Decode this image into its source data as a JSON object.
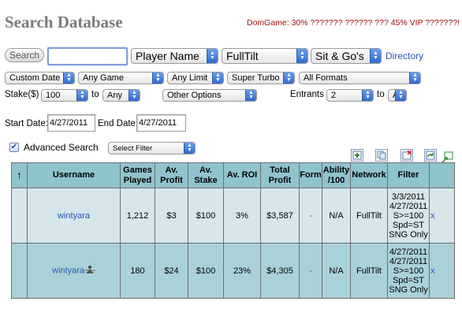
{
  "header": {
    "title": "Search Database",
    "promo": "DomGame: 30% ??????? ?????? ??? 45% VIP ???????!"
  },
  "search": {
    "button_label": "Search",
    "input_value": "",
    "type_select": "Player Name",
    "site_select": "FullTilt",
    "format_select": "Sit & Go's",
    "directory_link": "Directory"
  },
  "filters": {
    "date_select": "Custom Date",
    "game_select": "Any Game",
    "limit_select": "Any Limit",
    "speed_select": "Super Turbo",
    "formats_select": "All Formats",
    "stake_label": "Stake($)",
    "stake_from": "100",
    "stake_to_label": "to",
    "stake_to": "Any",
    "other_options": "Other Options",
    "entrants_label": "Entrants",
    "entrants_from": "2",
    "entrants_to_label": "to",
    "entrants_to": "Any"
  },
  "dates": {
    "start_label": "Start Date:",
    "start_value": "4/27/2011",
    "end_label": "End Date:",
    "end_value": "4/27/2011"
  },
  "advanced": {
    "checked": true,
    "label": "Advanced Search",
    "filter_select": "Select Filter"
  },
  "toolbar_icons": [
    "add-row-icon",
    "copy-table-icon",
    "delete-row-icon",
    "refresh-icon",
    "export-icon"
  ],
  "table": {
    "headers": {
      "sort": "↑",
      "username": "Username",
      "games": "Games Played",
      "profit": "Av. Profit",
      "stake": "Av. Stake",
      "roi": "Av. ROI",
      "total": "Total Profit",
      "form": "Form",
      "ability": "Ability /100",
      "network": "Network",
      "filter": "Filter"
    },
    "rows": [
      {
        "username": "wintyara",
        "games": "1,212",
        "profit": "$3",
        "stake": "$100",
        "roi": "3%",
        "total": "$3,587",
        "form": "-",
        "ability": "N/A",
        "network": "FullTilt",
        "filter": [
          "3/3/2011",
          "4/27/2011",
          "S>=100",
          "Spd=ST",
          "SNG Only"
        ],
        "remove": "x"
      },
      {
        "username": "wintyara",
        "games": "180",
        "profit": "$24",
        "stake": "$100",
        "roi": "23%",
        "total": "$4,305",
        "form": "-",
        "ability": "N/A",
        "network": "FullTilt",
        "filter": [
          "4/27/2011",
          "4/27/2011",
          "S>=100",
          "Spd=ST",
          "SNG Only"
        ],
        "remove": "x"
      }
    ]
  }
}
